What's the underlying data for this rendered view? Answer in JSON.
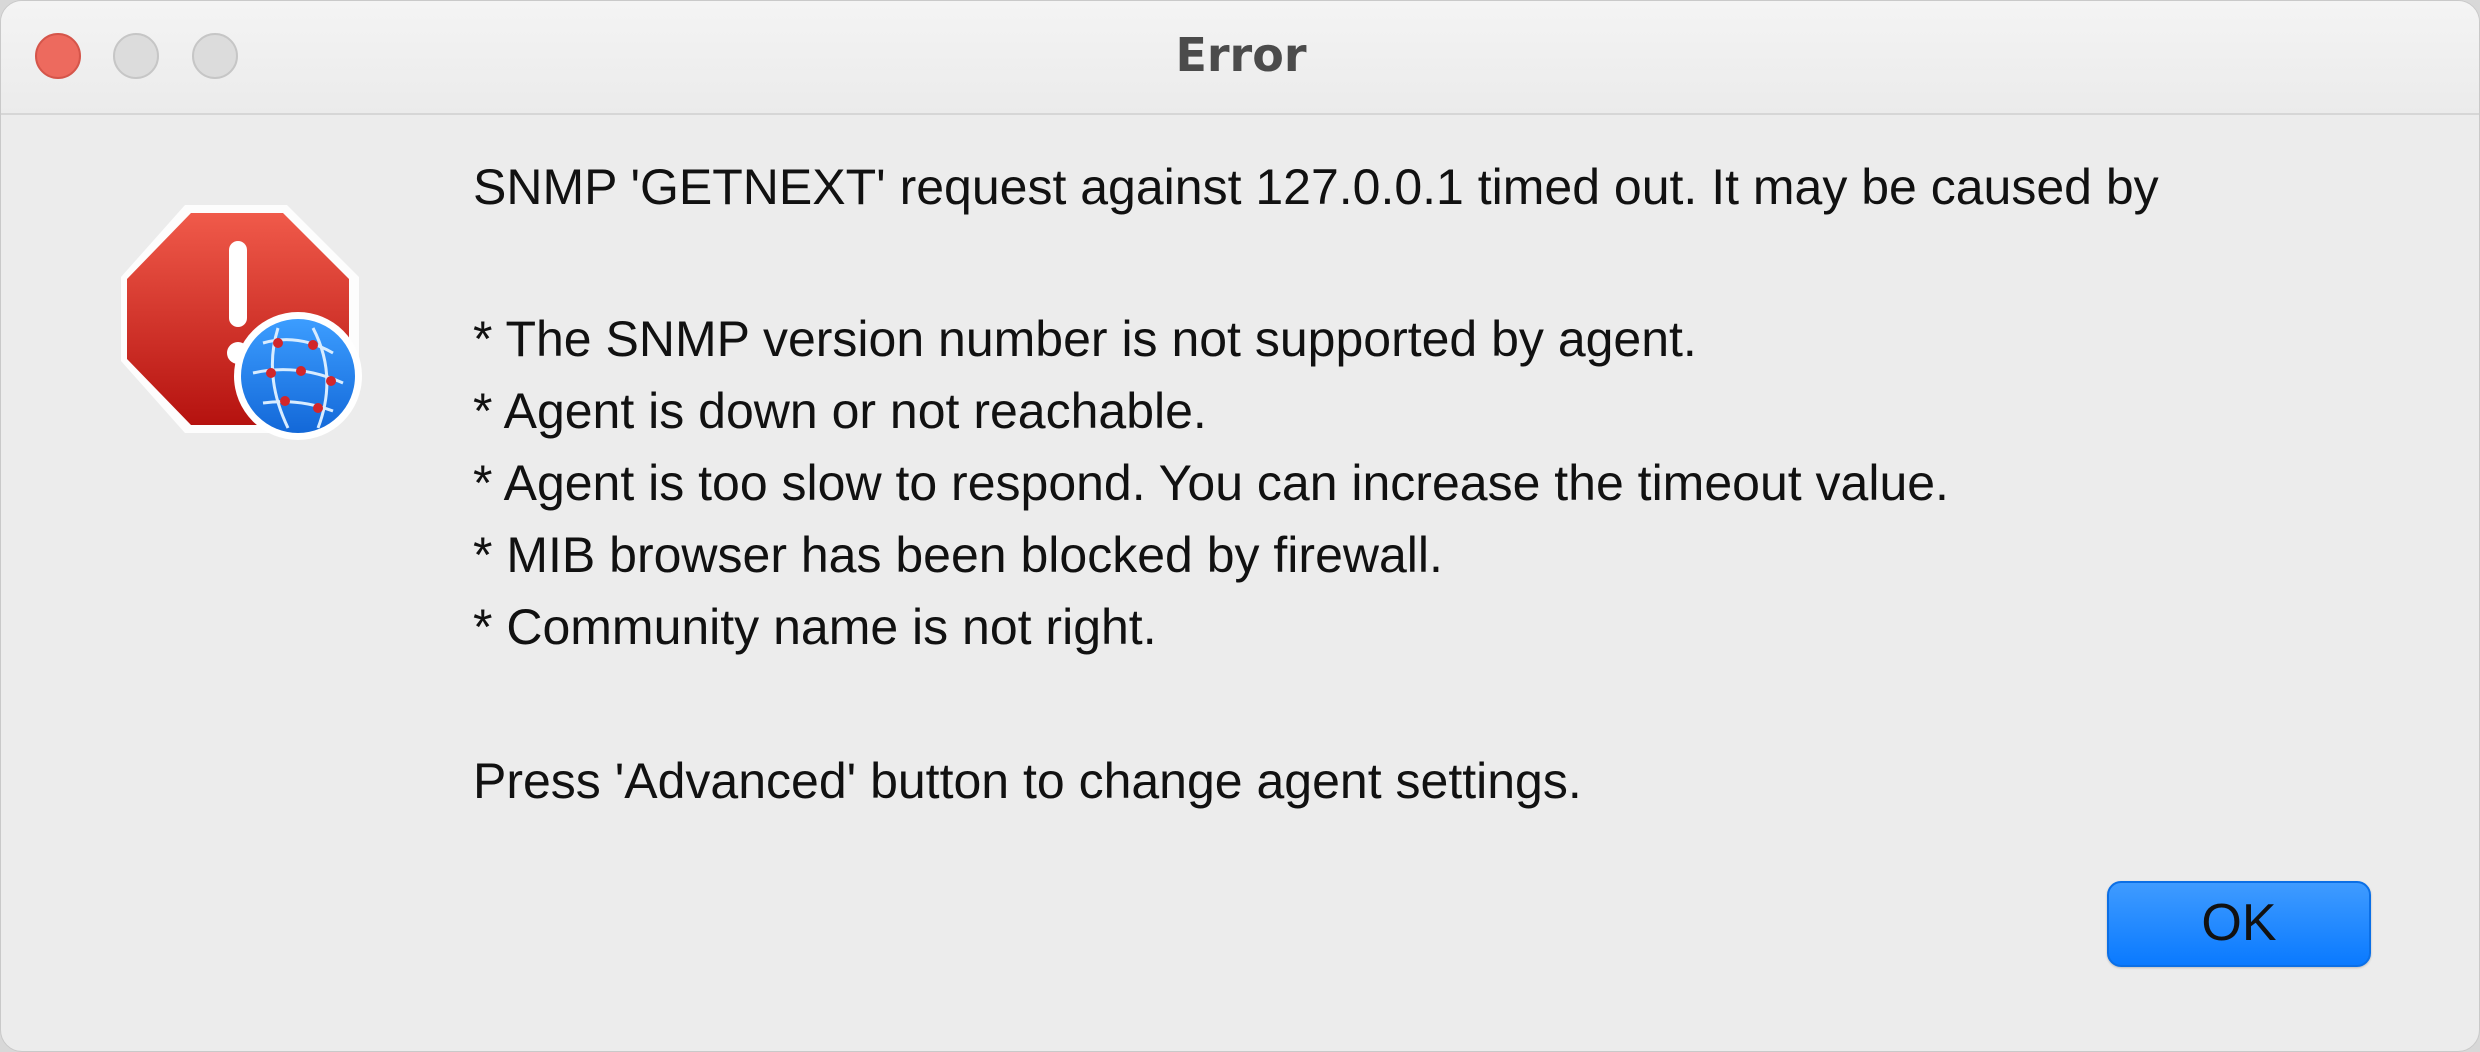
{
  "window": {
    "title": "Error",
    "traffic_lights": {
      "close_color": "#ed6a5e",
      "minimize_color": "#dcdcdc",
      "maximize_color": "#dcdcdc"
    }
  },
  "icon": {
    "name": "stop-sign-warning-icon",
    "badge_name": "network-globe-badge-icon",
    "colors": {
      "stop": "#c8201c",
      "badge": "#1f7ff0"
    }
  },
  "message": {
    "headline": "SNMP 'GETNEXT' request against 127.0.0.1 timed out. It may be caused by",
    "causes": [
      "* The SNMP version number is not supported by agent.",
      "* Agent is down or not reachable.",
      "* Agent is too slow to respond. You can increase the timeout value.",
      "* MIB browser has been blocked by firewall.",
      "* Community name is not right."
    ],
    "footer": "Press 'Advanced' button to change agent settings."
  },
  "buttons": {
    "ok_label": "OK",
    "ok_color": "#0a7aff"
  }
}
